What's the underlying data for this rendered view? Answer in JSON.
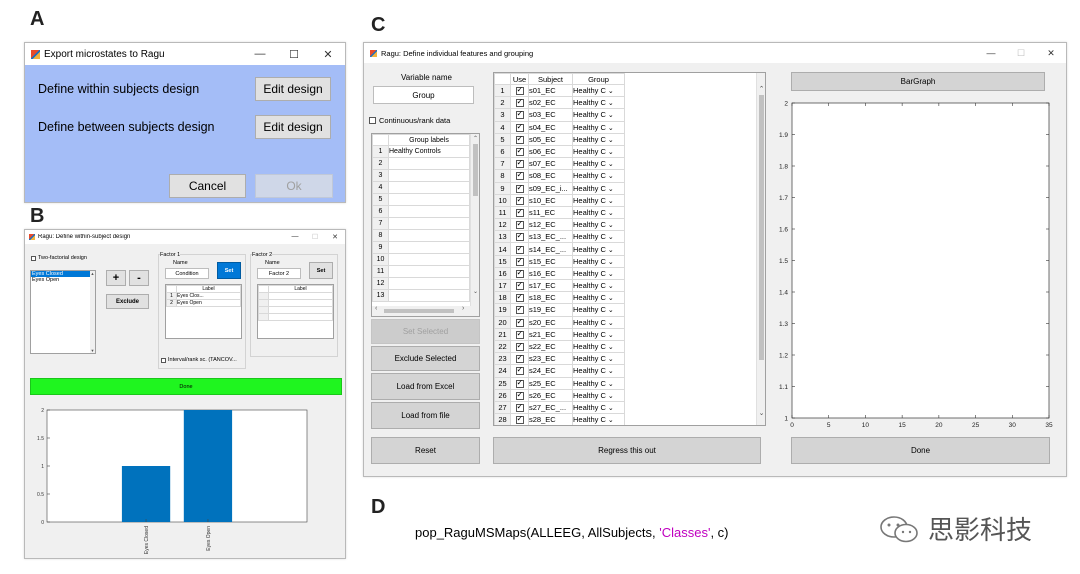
{
  "letters": {
    "a": "A",
    "b": "B",
    "c": "C",
    "d": "D"
  },
  "panelA": {
    "title": "Export microstates to Ragu",
    "bg_color": "#a4bdf7",
    "within_label": "Define within subjects design",
    "between_label": "Define between subjects design",
    "edit_within": "Edit design",
    "edit_between": "Edit design",
    "cancel": "Cancel",
    "ok": "Ok"
  },
  "panelB": {
    "title": "Ragu: Define within-subject design",
    "two_factorial": "Two-factorial design",
    "list_items": [
      "Eyes Closed",
      "Eyes Open"
    ],
    "plus": "+",
    "minus": "-",
    "exclude": "Exclude",
    "factor1": {
      "title": "Factor 1",
      "name_label": "Name",
      "name_value": "Condition",
      "set": "Set",
      "col_label": "Label",
      "rows": [
        {
          "n": "1",
          "label": "Eyes Clos..."
        },
        {
          "n": "2",
          "label": "Eyes Open"
        }
      ]
    },
    "factor2": {
      "title": "Factor 2",
      "name_label": "Name",
      "name_value": "Factor 2",
      "set": "Set",
      "col_label": "Label"
    },
    "interval": "Interval/rank sc. (TANCOV...",
    "done": "Done",
    "done_color": "#1ff51f",
    "chart_data": {
      "type": "bar",
      "categories": [
        "Eyes Closed",
        "Eyes Open"
      ],
      "values": [
        1,
        2
      ],
      "ylim": [
        0,
        2
      ],
      "yticks": [
        "0",
        "0.5",
        "1",
        "1.5",
        "2"
      ],
      "bar_color": "#0072bd",
      "grid": false
    }
  },
  "panelC": {
    "title": "Ragu: Define individual features and grouping",
    "variable_name_label": "Variable name",
    "variable_name_value": "Group",
    "continuous": "Continuous/rank data",
    "group_labels_header": "Group labels",
    "group_rows": [
      "1",
      "2",
      "3",
      "4",
      "5",
      "6",
      "7",
      "8",
      "9",
      "10",
      "11",
      "12",
      "13"
    ],
    "group_first_value": "Healthy Controls",
    "set_selected": "Set Selected",
    "exclude_selected": "Exclude Selected",
    "load_excel": "Load from Excel",
    "load_file": "Load from file",
    "reset": "Reset",
    "regress": "Regress this out",
    "subject_table": {
      "headers": [
        "Use",
        "Subject",
        "Group"
      ],
      "group_value": "Healthy C",
      "rows": [
        {
          "n": "1",
          "s": "s01_EC"
        },
        {
          "n": "2",
          "s": "s02_EC"
        },
        {
          "n": "3",
          "s": "s03_EC"
        },
        {
          "n": "4",
          "s": "s04_EC"
        },
        {
          "n": "5",
          "s": "s05_EC"
        },
        {
          "n": "6",
          "s": "s06_EC"
        },
        {
          "n": "7",
          "s": "s07_EC"
        },
        {
          "n": "8",
          "s": "s08_EC"
        },
        {
          "n": "9",
          "s": "s09_EC_i..."
        },
        {
          "n": "10",
          "s": "s10_EC"
        },
        {
          "n": "11",
          "s": "s11_EC"
        },
        {
          "n": "12",
          "s": "s12_EC"
        },
        {
          "n": "13",
          "s": "s13_EC_..."
        },
        {
          "n": "14",
          "s": "s14_EC_..."
        },
        {
          "n": "15",
          "s": "s15_EC"
        },
        {
          "n": "16",
          "s": "s16_EC"
        },
        {
          "n": "17",
          "s": "s17_EC"
        },
        {
          "n": "18",
          "s": "s18_EC"
        },
        {
          "n": "19",
          "s": "s19_EC"
        },
        {
          "n": "20",
          "s": "s20_EC"
        },
        {
          "n": "21",
          "s": "s21_EC"
        },
        {
          "n": "22",
          "s": "s22_EC"
        },
        {
          "n": "23",
          "s": "s23_EC"
        },
        {
          "n": "24",
          "s": "s24_EC"
        },
        {
          "n": "25",
          "s": "s25_EC"
        },
        {
          "n": "26",
          "s": "s26_EC"
        },
        {
          "n": "27",
          "s": "s27_EC_..."
        },
        {
          "n": "28",
          "s": "s28_EC"
        }
      ]
    },
    "bargraph": "BarGraph",
    "done": "Done",
    "chart_data": {
      "type": "line",
      "series": [],
      "xlim": [
        0,
        35
      ],
      "ylim": [
        1,
        2
      ],
      "xticks": [
        "0",
        "5",
        "10",
        "15",
        "20",
        "25",
        "30",
        "35"
      ],
      "yticks": [
        "1",
        "1.1",
        "1.2",
        "1.3",
        "1.4",
        "1.5",
        "1.6",
        "1.7",
        "1.8",
        "1.9",
        "2"
      ],
      "grid": false
    }
  },
  "panelD": {
    "code_prefix": "pop_RaguMSMaps(ALLEEG, AllSubjects, ",
    "code_string": "'Classes'",
    "code_suffix": ", c)",
    "string_color": "#c000c0"
  },
  "watermark": {
    "text": "思影科技"
  },
  "window_controls": {
    "minimize": "—",
    "maximize": "☐",
    "close": "✕"
  }
}
